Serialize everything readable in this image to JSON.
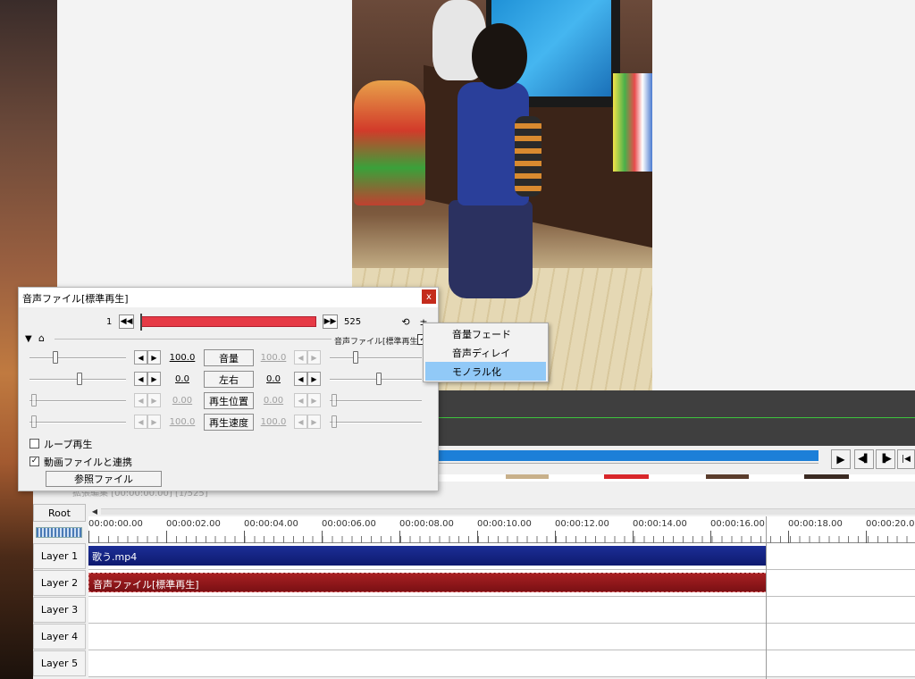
{
  "dialog": {
    "title": "音声ファイル[標準再生]",
    "close_glyph": "x",
    "frame_start": "1",
    "frame_end": "525",
    "filter_label": "音声ファイル[標準再生]",
    "filter_checked_glyph": "✓",
    "params": [
      {
        "label": "音量",
        "value_left": "100.0",
        "value_right": "100.0"
      },
      {
        "label": "左右",
        "value_left": "0.0",
        "value_right": "0.0"
      },
      {
        "label": "再生位置",
        "value_left": "0.00",
        "value_right": "0.00"
      },
      {
        "label": "再生速度",
        "value_left": "100.0",
        "value_right": "100.0"
      }
    ],
    "loop_label": "ループ再生",
    "loop_checked": false,
    "link_label": "動画ファイルと連携",
    "link_checked_glyph": "✓",
    "ref_file_label": "参照ファイル"
  },
  "context_menu": {
    "items": [
      "音量フェード",
      "音声ディレイ",
      "モノラル化"
    ],
    "selected_index": 2
  },
  "timeline": {
    "ghost_text": "拡張編集 [00:00:00.00] [1/525]",
    "root_label": "Root",
    "time_labels": [
      "00:00:00.00",
      "00:00:02.00",
      "00:00:04.00",
      "00:00:06.00",
      "00:00:08.00",
      "00:00:10.00",
      "00:00:12.00",
      "00:00:14.00",
      "00:00:16.00",
      "00:00:18.00",
      "00:00:20.00"
    ],
    "layers": [
      {
        "label": "Layer 1",
        "clip": "歌う.mp4",
        "clip_type": "video"
      },
      {
        "label": "Layer 2",
        "clip": "音声ファイル[標準再生]",
        "clip_type": "audio"
      },
      {
        "label": "Layer 3",
        "clip": null
      },
      {
        "label": "Layer 4",
        "clip": null
      },
      {
        "label": "Layer 5",
        "clip": null
      }
    ]
  },
  "playback": {
    "play_glyph": "▶",
    "prev_frame_glyph": "◀▌",
    "next_frame_glyph": "▐▶",
    "to_start_glyph": "|◀"
  },
  "colors": {
    "video_clip": "#1c2e96",
    "audio_clip": "#a82022",
    "frame_bar": "#e63a46",
    "seek_bar": "#1c7fd8",
    "menu_highlight": "#91c9f7",
    "close_button": "#c42b1c"
  }
}
